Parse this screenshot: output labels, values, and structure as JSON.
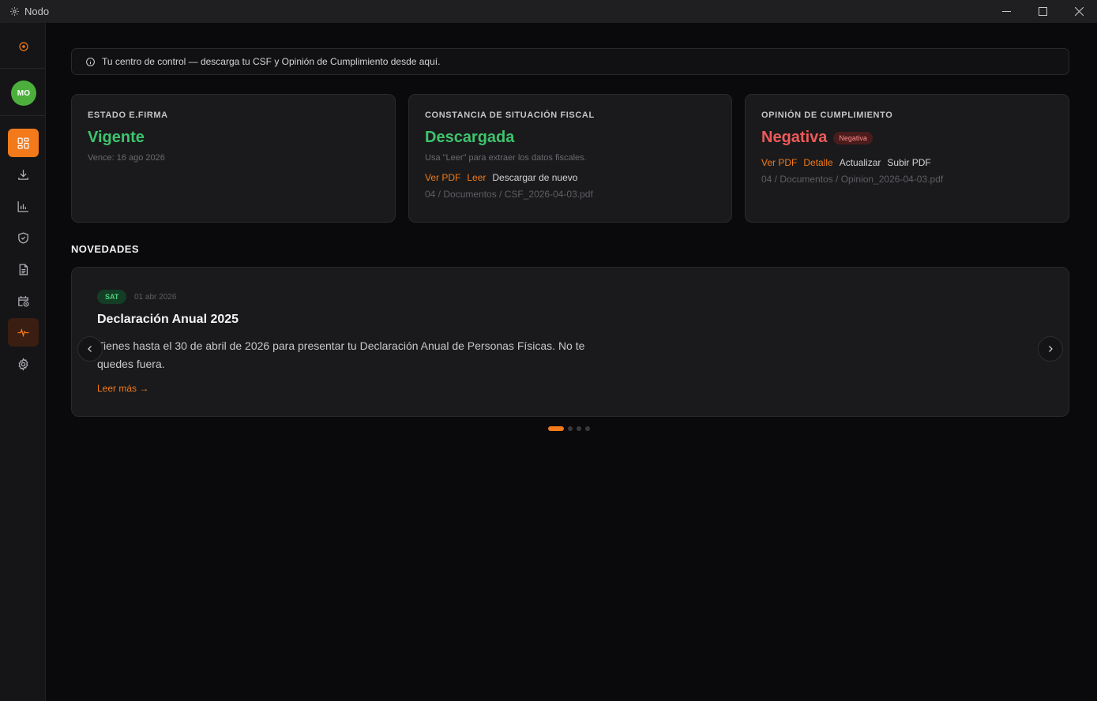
{
  "window": {
    "title": "Nodo"
  },
  "sidebar": {
    "avatar_initials": "MO",
    "items": [
      {
        "name": "dashboard",
        "icon": "dashboard-grid-icon",
        "active": true
      },
      {
        "name": "downloads",
        "icon": "download-icon"
      },
      {
        "name": "reports",
        "icon": "bar-chart-icon"
      },
      {
        "name": "compliance",
        "icon": "shield-check-icon"
      },
      {
        "name": "documents",
        "icon": "document-icon"
      },
      {
        "name": "calendar",
        "icon": "calendar-clock-icon"
      },
      {
        "name": "activity",
        "icon": "pulse-icon",
        "highlight": true
      },
      {
        "name": "settings",
        "icon": "gear-icon"
      }
    ]
  },
  "banner": {
    "text": "Tu centro de control — descarga tu CSF y Opinión de Cumplimiento desde aquí."
  },
  "cards": {
    "efirma": {
      "label": "ESTADO E.FIRMA",
      "status": "Vigente",
      "sub": "Vence: 16 ago 2026"
    },
    "csf": {
      "label": "CONSTANCIA DE SITUACIÓN FISCAL",
      "status": "Descargada",
      "sub": "Usa \"Leer\" para extraer los datos fiscales.",
      "actions": {
        "view": "Ver PDF",
        "read": "Leer",
        "redownload": "Descargar de nuevo"
      },
      "path": "04 / Documentos / CSF_2026-04-03.pdf"
    },
    "opinion": {
      "label": "OPINIÓN DE CUMPLIMIENTO",
      "status": "Negativa",
      "badge": "Negativa",
      "actions": {
        "view": "Ver PDF",
        "detail": "Detalle",
        "update": "Actualizar",
        "upload": "Subir PDF"
      },
      "path": "04 / Documentos / Opinion_2026-04-03.pdf"
    }
  },
  "news": {
    "section_title": "NOVEDADES",
    "tag": "SAT",
    "date": "01 abr 2026",
    "headline": "Declaración Anual 2025",
    "body": "Tienes hasta el 30 de abril de 2026 para presentar tu Declaración Anual de Personas Físicas. No te quedes fuera.",
    "more": "Leer más →",
    "slide_count": 4,
    "active_slide": 1
  },
  "colors": {
    "accent": "#f27a1a",
    "success": "#3ec46d",
    "danger": "#ef5a5a",
    "avatar": "#4caf3c"
  }
}
